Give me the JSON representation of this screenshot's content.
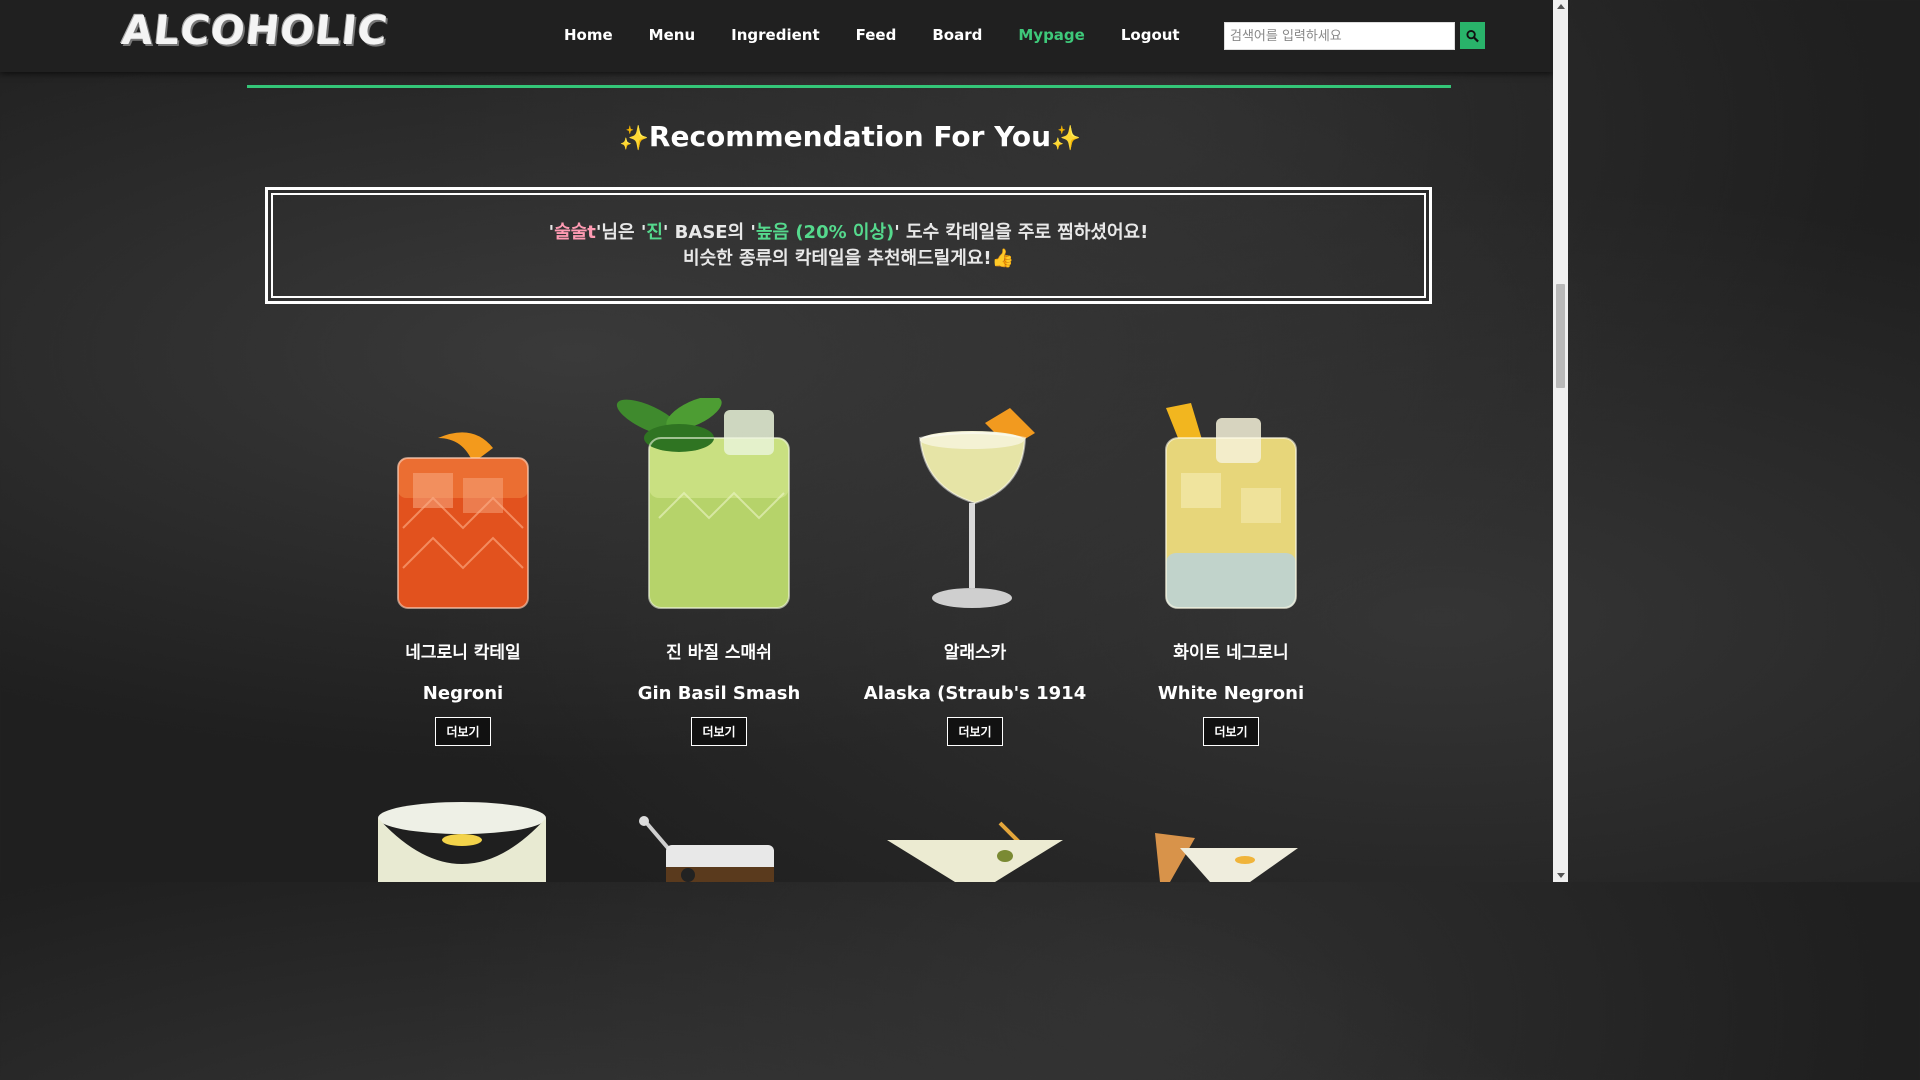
{
  "brand": {
    "logo": "ALCOHOLIC"
  },
  "nav": {
    "items": [
      {
        "label": "Home"
      },
      {
        "label": "Menu"
      },
      {
        "label": "Ingredient"
      },
      {
        "label": "Feed"
      },
      {
        "label": "Board"
      },
      {
        "label": "Mypage",
        "active": true
      },
      {
        "label": "Logout"
      }
    ]
  },
  "search": {
    "placeholder": "검색어를 입력하세요",
    "icon": "search-icon"
  },
  "colors": {
    "accent": "#34c678",
    "highlight_pink": "#ff9bb3",
    "highlight_green": "#55d98d"
  },
  "recommend": {
    "title": "Recommendation For You",
    "sparkle": "✨",
    "quote_open": "'",
    "username": "술술t",
    "mid1": "'님은 '",
    "base": "진",
    "mid2": "' BASE의 '",
    "strength": "높음 (20% 이상)",
    "tail": "' 도수 칵테일을 주로 찜하셨어요!",
    "line2": "비슷한 종류의 칵테일을 추천해드릴게요!",
    "emoji": "👍"
  },
  "cards": [
    {
      "name_kr": "네그로니 칵테일",
      "name_en": "Negroni",
      "button": "더보기"
    },
    {
      "name_kr": "진 바질 스매쉬",
      "name_en": "Gin Basil Smash",
      "button": "더보기"
    },
    {
      "name_kr": "알래스카",
      "name_en": "Alaska (Straub's 1914",
      "button": "더보기"
    },
    {
      "name_kr": "화이트 네그로니",
      "name_en": "White Negroni",
      "button": "더보기"
    }
  ]
}
